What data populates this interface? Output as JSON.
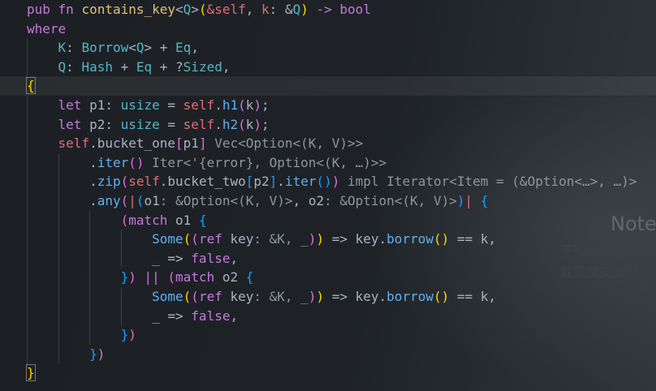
{
  "editor": {
    "language": "Rust",
    "watermark": {
      "title": "Note",
      "line1": "不知是谁说过",
      "line2": "就是镜皮装酷"
    },
    "lines": [
      {
        "indent": 0,
        "current": false,
        "tokens": [
          {
            "t": "pub fn ",
            "c": "kw"
          },
          {
            "t": "contains_key",
            "c": "fn"
          },
          {
            "t": "<",
            "c": "p"
          },
          {
            "t": "Q",
            "c": "ty"
          },
          {
            "t": ">",
            "c": "p"
          },
          {
            "t": "(",
            "c": "b1"
          },
          {
            "t": "&self",
            "c": "var"
          },
          {
            "t": ", ",
            "c": "p"
          },
          {
            "t": "k",
            "c": "var"
          },
          {
            "t": ": &",
            "c": "p"
          },
          {
            "t": "Q",
            "c": "ty"
          },
          {
            "t": ")",
            "c": "b1"
          },
          {
            "t": " -> ",
            "c": "op"
          },
          {
            "t": "bool",
            "c": "kw"
          }
        ]
      },
      {
        "indent": 0,
        "current": false,
        "tokens": [
          {
            "t": "where",
            "c": "kw"
          }
        ]
      },
      {
        "indent": 1,
        "current": false,
        "tokens": [
          {
            "t": "K",
            "c": "ty"
          },
          {
            "t": ": ",
            "c": "p"
          },
          {
            "t": "Borrow",
            "c": "ty"
          },
          {
            "t": "<",
            "c": "p"
          },
          {
            "t": "Q",
            "c": "ty"
          },
          {
            "t": "> + ",
            "c": "p"
          },
          {
            "t": "Eq",
            "c": "ty"
          },
          {
            "t": ",",
            "c": "p"
          }
        ]
      },
      {
        "indent": 1,
        "current": false,
        "tokens": [
          {
            "t": "Q",
            "c": "ty"
          },
          {
            "t": ": ",
            "c": "p"
          },
          {
            "t": "Hash",
            "c": "ty"
          },
          {
            "t": " + ",
            "c": "p"
          },
          {
            "t": "Eq",
            "c": "ty"
          },
          {
            "t": " + ?",
            "c": "p"
          },
          {
            "t": "Sized",
            "c": "ty"
          },
          {
            "t": ",",
            "c": "p"
          }
        ]
      },
      {
        "indent": 0,
        "current": true,
        "tokens": [
          {
            "t": "{",
            "c": "b1",
            "box": true
          }
        ]
      },
      {
        "indent": 1,
        "current": false,
        "tokens": [
          {
            "t": "let ",
            "c": "kw"
          },
          {
            "t": "p1",
            "c": "p"
          },
          {
            "t": ": ",
            "c": "p"
          },
          {
            "t": "usize",
            "c": "ty"
          },
          {
            "t": " = ",
            "c": "p"
          },
          {
            "t": "self",
            "c": "var"
          },
          {
            "t": ".",
            "c": "p"
          },
          {
            "t": "h1",
            "c": "meth"
          },
          {
            "t": "(",
            "c": "b2"
          },
          {
            "t": "k",
            "c": "p"
          },
          {
            "t": ")",
            "c": "b2"
          },
          {
            "t": ";",
            "c": "p"
          }
        ]
      },
      {
        "indent": 1,
        "current": false,
        "tokens": [
          {
            "t": "let ",
            "c": "kw"
          },
          {
            "t": "p2",
            "c": "p"
          },
          {
            "t": ": ",
            "c": "p"
          },
          {
            "t": "usize",
            "c": "ty"
          },
          {
            "t": " = ",
            "c": "p"
          },
          {
            "t": "self",
            "c": "var"
          },
          {
            "t": ".",
            "c": "p"
          },
          {
            "t": "h2",
            "c": "meth"
          },
          {
            "t": "(",
            "c": "b2"
          },
          {
            "t": "k",
            "c": "p"
          },
          {
            "t": ")",
            "c": "b2"
          },
          {
            "t": ";",
            "c": "p"
          }
        ]
      },
      {
        "indent": 1,
        "current": false,
        "tokens": [
          {
            "t": "self",
            "c": "var"
          },
          {
            "t": ".",
            "c": "p"
          },
          {
            "t": "bucket_one",
            "c": "p"
          },
          {
            "t": "[",
            "c": "b2"
          },
          {
            "t": "p1",
            "c": "p"
          },
          {
            "t": "]",
            "c": "b2"
          },
          {
            "t": " Vec<Option<(K, V)>>",
            "c": "hint"
          }
        ]
      },
      {
        "indent": 2,
        "current": false,
        "tokens": [
          {
            "t": ".",
            "c": "p"
          },
          {
            "t": "iter",
            "c": "meth"
          },
          {
            "t": "()",
            "c": "b2"
          },
          {
            "t": " Iter<'{error}, Option<(K, …)>>",
            "c": "hint"
          }
        ]
      },
      {
        "indent": 2,
        "current": false,
        "tokens": [
          {
            "t": ".",
            "c": "p"
          },
          {
            "t": "zip",
            "c": "meth"
          },
          {
            "t": "(",
            "c": "b2"
          },
          {
            "t": "self",
            "c": "var"
          },
          {
            "t": ".",
            "c": "p"
          },
          {
            "t": "bucket_two",
            "c": "p"
          },
          {
            "t": "[",
            "c": "b3"
          },
          {
            "t": "p2",
            "c": "p"
          },
          {
            "t": "]",
            "c": "b3"
          },
          {
            "t": ".",
            "c": "p"
          },
          {
            "t": "iter",
            "c": "meth"
          },
          {
            "t": "()",
            "c": "b3"
          },
          {
            "t": ")",
            "c": "b2"
          },
          {
            "t": " impl Iterator<Item = (&Option<…>, …)>",
            "c": "hint"
          }
        ]
      },
      {
        "indent": 2,
        "current": false,
        "tokens": [
          {
            "t": ".",
            "c": "p"
          },
          {
            "t": "any",
            "c": "meth"
          },
          {
            "t": "(",
            "c": "b2"
          },
          {
            "t": "|",
            "c": "var"
          },
          {
            "t": "(",
            "c": "b3"
          },
          {
            "t": "o1",
            "c": "p"
          },
          {
            "t": ": &Option<(K, V)>",
            "c": "hint"
          },
          {
            "t": ", ",
            "c": "p"
          },
          {
            "t": "o2",
            "c": "p"
          },
          {
            "t": ": &Option<(K, V)>",
            "c": "hint"
          },
          {
            "t": ")",
            "c": "b3"
          },
          {
            "t": "|",
            "c": "var"
          },
          {
            "t": " ",
            "c": "p"
          },
          {
            "t": "{",
            "c": "b3"
          }
        ]
      },
      {
        "indent": 3,
        "current": false,
        "tokens": [
          {
            "t": "(",
            "c": "b2"
          },
          {
            "t": "match ",
            "c": "kw"
          },
          {
            "t": "o1",
            "c": "p"
          },
          {
            "t": " ",
            "c": "p"
          },
          {
            "t": "{",
            "c": "b3"
          }
        ]
      },
      {
        "indent": 4,
        "current": false,
        "tokens": [
          {
            "t": "Some",
            "c": "meth"
          },
          {
            "t": "(",
            "c": "b1"
          },
          {
            "t": "(",
            "c": "b2"
          },
          {
            "t": "ref ",
            "c": "kw"
          },
          {
            "t": "key",
            "c": "p"
          },
          {
            "t": ": &K, _",
            "c": "hint"
          },
          {
            "t": ")",
            "c": "b2"
          },
          {
            "t": ")",
            "c": "b1"
          },
          {
            "t": " => ",
            "c": "p"
          },
          {
            "t": "key",
            "c": "p"
          },
          {
            "t": ".",
            "c": "p"
          },
          {
            "t": "borrow",
            "c": "meth"
          },
          {
            "t": "()",
            "c": "b1"
          },
          {
            "t": " == ",
            "c": "p"
          },
          {
            "t": "k",
            "c": "p"
          },
          {
            "t": ",",
            "c": "p"
          }
        ]
      },
      {
        "indent": 4,
        "current": false,
        "tokens": [
          {
            "t": "_",
            "c": "p"
          },
          {
            "t": " => ",
            "c": "p"
          },
          {
            "t": "false",
            "c": "kw"
          },
          {
            "t": ",",
            "c": "p"
          }
        ]
      },
      {
        "indent": 3,
        "current": false,
        "tokens": [
          {
            "t": "}",
            "c": "b3"
          },
          {
            "t": ")",
            "c": "b2"
          },
          {
            "t": " || ",
            "c": "op"
          },
          {
            "t": "(",
            "c": "b2"
          },
          {
            "t": "match ",
            "c": "kw"
          },
          {
            "t": "o2",
            "c": "p"
          },
          {
            "t": " ",
            "c": "p"
          },
          {
            "t": "{",
            "c": "b3"
          }
        ]
      },
      {
        "indent": 4,
        "current": false,
        "tokens": [
          {
            "t": "Some",
            "c": "meth"
          },
          {
            "t": "(",
            "c": "b1"
          },
          {
            "t": "(",
            "c": "b2"
          },
          {
            "t": "ref ",
            "c": "kw"
          },
          {
            "t": "key",
            "c": "p"
          },
          {
            "t": ": &K, _",
            "c": "hint"
          },
          {
            "t": ")",
            "c": "b2"
          },
          {
            "t": ")",
            "c": "b1"
          },
          {
            "t": " => ",
            "c": "p"
          },
          {
            "t": "key",
            "c": "p"
          },
          {
            "t": ".",
            "c": "p"
          },
          {
            "t": "borrow",
            "c": "meth"
          },
          {
            "t": "()",
            "c": "b1"
          },
          {
            "t": " == ",
            "c": "p"
          },
          {
            "t": "k",
            "c": "p"
          },
          {
            "t": ",",
            "c": "p"
          }
        ]
      },
      {
        "indent": 4,
        "current": false,
        "tokens": [
          {
            "t": "_",
            "c": "p"
          },
          {
            "t": " => ",
            "c": "p"
          },
          {
            "t": "false",
            "c": "kw"
          },
          {
            "t": ",",
            "c": "p"
          }
        ]
      },
      {
        "indent": 3,
        "current": false,
        "tokens": [
          {
            "t": "}",
            "c": "b3"
          },
          {
            "t": ")",
            "c": "b2"
          }
        ]
      },
      {
        "indent": 2,
        "current": false,
        "tokens": [
          {
            "t": "}",
            "c": "b3"
          },
          {
            "t": ")",
            "c": "b2"
          }
        ]
      },
      {
        "indent": 0,
        "current": false,
        "tokens": [
          {
            "t": "}",
            "c": "b1",
            "box": true
          }
        ]
      }
    ]
  }
}
